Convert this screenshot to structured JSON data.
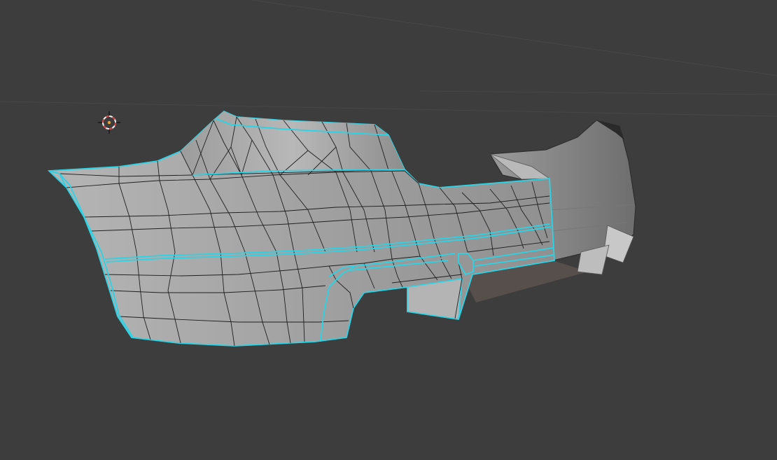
{
  "viewport": {
    "background": "#3d3d3d",
    "grid_color": "#474747"
  },
  "cursor_3d": {
    "icon": "3d-cursor-icon",
    "ring_red": "#d23a3a",
    "ring_white": "#f2f2f2",
    "center": "#f0a030"
  },
  "mesh": {
    "object": "bumper-mesh",
    "face_color": "#a9a9a9",
    "wire_color": "#1f1f1f",
    "seam_color": "#2ad4e6",
    "shadow_color": "#5a5450"
  }
}
